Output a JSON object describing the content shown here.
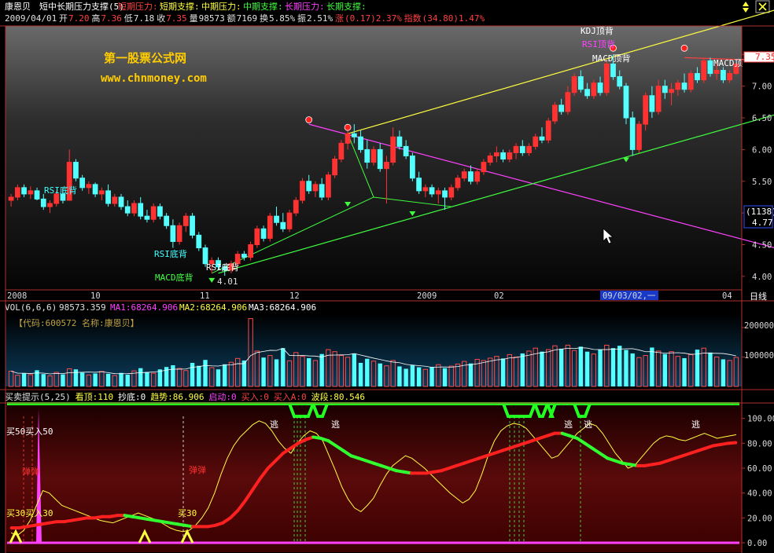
{
  "header": {
    "stock_name": "康恩贝",
    "indicator_name": "短中长期压力支撑(5)",
    "legend": [
      {
        "text": "短期压力:",
        "color": "#ff4040"
      },
      {
        "text": "短期支撑:",
        "color": "#ffff40"
      },
      {
        "text": "中期压力:",
        "color": "#ffff40"
      },
      {
        "text": "中期支撑:",
        "color": "#40ff40"
      },
      {
        "text": "长期压力:",
        "color": "#ff40ff"
      },
      {
        "text": "长期支撑:",
        "color": "#40ff40"
      }
    ],
    "quote": {
      "date": "2009/04/01",
      "open_label": "开",
      "open": "7.20",
      "high_label": "高",
      "high": "7.36",
      "low_label": "低",
      "low": "7.18",
      "close_label": "收",
      "close": "7.35",
      "volume_label": "量",
      "volume": "98573",
      "amount_label": "额",
      "amount": "7169",
      "turnover_label": "换",
      "turnover": "5.85%",
      "amplitude_label": "振",
      "amplitude": "2.51%",
      "change_label": "涨",
      "change": "(0.17)2.37%",
      "index_label": "指数",
      "index": "(34.80)1.47%"
    }
  },
  "watermark": {
    "line1": "第一股票公式网",
    "line2": "www.chnmoney.com"
  },
  "top_right_icons": [
    "arrow-up-down-icon",
    "close-icon"
  ],
  "price_panel": {
    "y_ticks": [
      "7.50",
      "7.00",
      "6.50",
      "6.00",
      "5.50",
      "5.00",
      "4.50",
      "4.00"
    ],
    "current_price_tag": "7.35",
    "side_box": {
      "line1": "(1138)",
      "line2": "4.77"
    },
    "low_marker_label": "4.01",
    "annotations": [
      "RSI底背",
      "RSI底背",
      "RSI底背",
      "MACD底背",
      "KDJ顶背",
      "RSI顶背",
      "MACD顶背",
      "MACD顶"
    ],
    "date_axis": [
      "2008",
      "10",
      "11",
      "12",
      "2009",
      "02",
      "09/03/02,一",
      "04"
    ],
    "date_axis_unit": "日线"
  },
  "volume_panel": {
    "header": {
      "name": "VOL(6,6,6)",
      "value": "98573.359",
      "ma1": "MA1:68264.906",
      "ma2": "MA2:68264.906",
      "ma3": "MA3:68264.906"
    },
    "info": "【代码:600572 名称:康恩贝】",
    "y_ticks": [
      "200000",
      "100000"
    ]
  },
  "osc_panel": {
    "header": [
      {
        "text": "买卖提示(5,25)",
        "color": "#e0e0e0"
      },
      {
        "text": "看顶:110",
        "color": "#ffff40"
      },
      {
        "text": "抄底:0",
        "color": "#ffffff"
      },
      {
        "text": "趋势:86.906",
        "color": "#ffff40"
      },
      {
        "text": "启动:0",
        "color": "#ff40ff"
      },
      {
        "text": "买入:0",
        "color": "#ff4040"
      },
      {
        "text": "买入A:0",
        "color": "#ff4040"
      },
      {
        "text": "波段:80.546",
        "color": "#ffff40"
      }
    ],
    "y_ticks": [
      "100.00",
      "80.00",
      "60.00",
      "40.00",
      "20.00",
      "0.00"
    ],
    "signals": {
      "buy50": "买50买入50",
      "buy30": "买30买入30",
      "buy30b": "买30",
      "rebound": "弹弹",
      "escape": "逃"
    }
  },
  "chart_data": [
    {
      "type": "candlestick",
      "title": "短中长期压力支撑(5)",
      "ylim": [
        3.8,
        7.95
      ],
      "y_ticks": [
        4.0,
        4.5,
        5.0,
        5.5,
        6.0,
        6.5,
        7.0,
        7.5
      ],
      "ohlc": [
        [
          5.2,
          5.3,
          5.1,
          5.25
        ],
        [
          5.25,
          5.45,
          5.2,
          5.4
        ],
        [
          5.4,
          5.45,
          5.25,
          5.3
        ],
        [
          5.3,
          5.42,
          5.22,
          5.35
        ],
        [
          5.35,
          5.4,
          5.2,
          5.22
        ],
        [
          5.22,
          5.3,
          5.05,
          5.1
        ],
        [
          5.1,
          5.2,
          5.0,
          5.15
        ],
        [
          5.15,
          5.35,
          5.1,
          5.3
        ],
        [
          5.3,
          5.4,
          5.15,
          5.2
        ],
        [
          5.2,
          6.0,
          5.2,
          5.8
        ],
        [
          5.8,
          5.85,
          5.5,
          5.55
        ],
        [
          5.55,
          5.6,
          5.35,
          5.4
        ],
        [
          5.4,
          5.5,
          5.3,
          5.45
        ],
        [
          5.45,
          5.48,
          5.25,
          5.3
        ],
        [
          5.3,
          5.4,
          5.2,
          5.35
        ],
        [
          5.35,
          5.45,
          5.1,
          5.15
        ],
        [
          5.15,
          5.3,
          5.1,
          5.25
        ],
        [
          5.25,
          5.3,
          5.05,
          5.1
        ],
        [
          5.1,
          5.2,
          4.95,
          5.0
        ],
        [
          5.0,
          5.2,
          4.95,
          5.15
        ],
        [
          5.15,
          5.25,
          4.9,
          4.95
        ],
        [
          4.95,
          5.05,
          4.85,
          4.9
        ],
        [
          4.9,
          5.15,
          4.85,
          5.1
        ],
        [
          5.1,
          5.15,
          4.9,
          4.95
        ],
        [
          4.95,
          5.0,
          4.75,
          4.8
        ],
        [
          4.8,
          4.9,
          4.45,
          4.55
        ],
        [
          4.55,
          4.85,
          4.5,
          4.8
        ],
        [
          4.8,
          5.0,
          4.7,
          4.95
        ],
        [
          4.95,
          5.0,
          4.6,
          4.65
        ],
        [
          4.65,
          4.7,
          4.4,
          4.45
        ],
        [
          4.45,
          4.5,
          4.15,
          4.2
        ],
        [
          4.2,
          4.3,
          4.05,
          4.25
        ],
        [
          4.25,
          4.3,
          4.1,
          4.15
        ],
        [
          4.15,
          4.2,
          4.01,
          4.1
        ],
        [
          4.1,
          4.25,
          4.05,
          4.2
        ],
        [
          4.2,
          4.4,
          4.15,
          4.35
        ],
        [
          4.35,
          4.4,
          4.25,
          4.3
        ],
        [
          4.3,
          4.55,
          4.25,
          4.5
        ],
        [
          4.5,
          4.8,
          4.45,
          4.75
        ],
        [
          4.75,
          4.8,
          4.55,
          4.6
        ],
        [
          4.6,
          5.0,
          4.55,
          4.95
        ],
        [
          4.95,
          5.1,
          4.8,
          4.85
        ],
        [
          4.85,
          5.0,
          4.7,
          4.75
        ],
        [
          4.75,
          5.05,
          4.7,
          5.0
        ],
        [
          5.0,
          5.25,
          4.95,
          5.2
        ],
        [
          5.2,
          5.55,
          5.15,
          5.5
        ],
        [
          5.5,
          5.6,
          5.3,
          5.35
        ],
        [
          5.35,
          5.5,
          5.25,
          5.45
        ],
        [
          5.45,
          5.55,
          5.2,
          5.25
        ],
        [
          5.25,
          5.65,
          5.2,
          5.6
        ],
        [
          5.6,
          5.9,
          5.55,
          5.85
        ],
        [
          5.85,
          6.15,
          5.8,
          6.1
        ],
        [
          6.1,
          6.3,
          6.0,
          6.25
        ],
        [
          6.25,
          6.4,
          6.1,
          6.2
        ],
        [
          6.2,
          6.3,
          5.95,
          6.0
        ],
        [
          6.0,
          6.15,
          5.7,
          5.8
        ],
        [
          5.8,
          6.05,
          5.75,
          6.0
        ],
        [
          6.0,
          6.1,
          5.65,
          5.7
        ],
        [
          5.7,
          5.9,
          5.15,
          5.8
        ],
        [
          5.8,
          6.35,
          5.75,
          6.2
        ],
        [
          6.2,
          6.3,
          6.0,
          6.05
        ],
        [
          6.05,
          6.15,
          5.85,
          5.9
        ],
        [
          5.9,
          5.95,
          5.5,
          5.55
        ],
        [
          5.55,
          5.65,
          5.3,
          5.35
        ],
        [
          5.35,
          5.45,
          5.25,
          5.4
        ],
        [
          5.4,
          5.45,
          5.25,
          5.3
        ],
        [
          5.3,
          5.4,
          5.15,
          5.35
        ],
        [
          5.35,
          5.4,
          5.05,
          5.25
        ],
        [
          5.25,
          5.45,
          5.2,
          5.4
        ],
        [
          5.4,
          5.6,
          5.35,
          5.55
        ],
        [
          5.55,
          5.7,
          5.5,
          5.65
        ],
        [
          5.65,
          5.75,
          5.45,
          5.5
        ],
        [
          5.5,
          5.7,
          5.45,
          5.65
        ],
        [
          5.65,
          5.85,
          5.6,
          5.8
        ],
        [
          5.8,
          5.95,
          5.75,
          5.9
        ],
        [
          5.9,
          6.05,
          5.8,
          5.95
        ],
        [
          5.95,
          6.0,
          5.8,
          5.85
        ],
        [
          5.85,
          6.0,
          5.8,
          5.95
        ],
        [
          5.95,
          6.1,
          5.85,
          6.05
        ],
        [
          6.05,
          6.15,
          5.9,
          5.95
        ],
        [
          5.95,
          6.1,
          5.9,
          6.05
        ],
        [
          6.05,
          6.25,
          6.0,
          6.2
        ],
        [
          6.2,
          6.35,
          6.1,
          6.15
        ],
        [
          6.15,
          6.5,
          6.1,
          6.45
        ],
        [
          6.45,
          6.75,
          6.4,
          6.7
        ],
        [
          6.7,
          6.8,
          6.55,
          6.6
        ],
        [
          6.6,
          7.0,
          6.55,
          6.9
        ],
        [
          6.9,
          7.2,
          6.85,
          7.15
        ],
        [
          7.15,
          7.25,
          6.9,
          6.95
        ],
        [
          6.95,
          7.05,
          6.8,
          6.85
        ],
        [
          6.85,
          7.1,
          6.8,
          7.05
        ],
        [
          7.05,
          7.15,
          6.85,
          6.9
        ],
        [
          6.9,
          7.4,
          6.85,
          7.35
        ],
        [
          7.35,
          7.5,
          7.1,
          7.15
        ],
        [
          7.15,
          7.25,
          6.95,
          7.0
        ],
        [
          7.0,
          7.05,
          6.4,
          6.5
        ],
        [
          6.5,
          6.6,
          5.9,
          6.0
        ],
        [
          6.0,
          6.45,
          5.95,
          6.4
        ],
        [
          6.4,
          6.9,
          6.3,
          6.85
        ],
        [
          6.85,
          7.0,
          6.5,
          6.6
        ],
        [
          6.6,
          7.1,
          6.55,
          7.0
        ],
        [
          7.0,
          7.1,
          6.8,
          6.9
        ],
        [
          6.9,
          7.05,
          6.7,
          6.95
        ],
        [
          6.95,
          7.1,
          6.85,
          7.05
        ],
        [
          7.05,
          7.2,
          6.9,
          6.95
        ],
        [
          6.95,
          7.25,
          6.9,
          7.2
        ],
        [
          7.2,
          7.3,
          7.05,
          7.1
        ],
        [
          7.1,
          7.45,
          7.05,
          7.4
        ],
        [
          7.4,
          7.45,
          7.15,
          7.2
        ],
        [
          7.2,
          7.35,
          7.1,
          7.25
        ],
        [
          7.25,
          7.3,
          7.05,
          7.1
        ],
        [
          7.1,
          7.25,
          7.05,
          7.2
        ],
        [
          7.2,
          7.36,
          7.18,
          7.35
        ]
      ],
      "lines": [
        {
          "name": "中期压力",
          "color": "#ffff40",
          "from": [
            52,
            6.25
          ],
          "to": [
            118,
            8.2
          ]
        },
        {
          "name": "长期压力",
          "color": "#ff40ff",
          "from": [
            46,
            6.4
          ],
          "to": [
            118,
            4.45
          ]
        },
        {
          "name": "中期支撑",
          "color": "#40ff40",
          "from": [
            32,
            4.05
          ],
          "to": [
            118,
            6.55
          ]
        },
        {
          "name": "短期压力",
          "color": "#ff4040",
          "from": [
            104,
            7.45
          ],
          "to": [
            118,
            7.4
          ]
        }
      ]
    },
    {
      "type": "bar",
      "title": "VOL(6,6,6)",
      "ylim": [
        0,
        245000
      ],
      "y_ticks": [
        100000,
        200000
      ],
      "values": [
        52000,
        38000,
        45000,
        40000,
        55000,
        42000,
        36000,
        48000,
        41000,
        60000,
        58000,
        47000,
        39000,
        44000,
        51000,
        43000,
        37000,
        46000,
        40000,
        53000,
        62000,
        49000,
        45000,
        58000,
        66000,
        72000,
        61000,
        54000,
        80000,
        70000,
        90000,
        64000,
        58000,
        75000,
        82000,
        95000,
        88000,
        230000,
        120000,
        98000,
        105000,
        92000,
        130000,
        87000,
        115000,
        102000,
        96000,
        88000,
        110000,
        125000,
        118000,
        105000,
        99000,
        112000,
        80000,
        94000,
        86000,
        78000,
        70000,
        88000,
        68000,
        60000,
        72000,
        65000,
        58000,
        66000,
        74000,
        62000,
        69000,
        76000,
        85000,
        78000,
        92000,
        88000,
        96000,
        102000,
        95000,
        108000,
        100000,
        112000,
        120000,
        130000,
        118000,
        125000,
        138000,
        128000,
        140000,
        122000,
        135000,
        118000,
        110000,
        125000,
        140000,
        130000,
        138000,
        124000,
        112000,
        98000,
        105000,
        132000,
        120000,
        110000,
        118000,
        102000,
        96000,
        108000,
        125000,
        130000,
        115000,
        100000,
        92000,
        88000,
        98573
      ],
      "ma_values": {
        "ma1": 68264.906,
        "ma2": 68264.906,
        "ma3": 68264.906
      }
    },
    {
      "type": "line",
      "title": "买卖提示(5,25)",
      "ylim": [
        0,
        110
      ],
      "y_ticks": [
        0,
        20,
        40,
        60,
        80,
        100
      ],
      "series": [
        {
          "name": "趋势",
          "color": "#ffff40",
          "values": [
            8,
            6,
            10,
            18,
            30,
            42,
            40,
            35,
            30,
            28,
            26,
            24,
            22,
            20,
            18,
            17,
            16,
            18,
            20,
            22,
            24,
            22,
            20,
            18,
            15,
            12,
            10,
            9,
            10,
            14,
            20,
            28,
            40,
            55,
            68,
            78,
            85,
            90,
            95,
            98,
            96,
            90,
            82,
            76,
            72,
            80,
            86,
            90,
            88,
            82,
            70,
            58,
            45,
            35,
            28,
            25,
            30,
            36,
            46,
            55,
            62,
            66,
            70,
            68,
            64,
            60,
            55,
            50,
            45,
            40,
            36,
            32,
            35,
            42,
            55,
            70,
            82,
            90,
            94,
            96,
            95,
            92,
            86,
            80,
            74,
            68,
            70,
            76,
            82,
            88,
            92,
            96,
            94,
            88,
            80,
            72,
            66,
            60,
            62,
            68,
            74,
            80,
            84,
            86,
            85,
            83,
            82,
            84,
            86,
            88,
            86,
            84,
            85,
            86,
            86.9
          ]
        },
        {
          "name": "波段",
          "color": "#ff3030",
          "values": [
            12,
            12,
            13,
            14,
            15,
            16,
            17,
            17,
            18,
            19,
            20,
            20,
            21,
            21,
            22,
            22,
            21,
            20,
            19,
            18,
            17,
            16,
            15,
            14,
            13,
            13,
            13,
            14,
            16,
            20,
            26,
            34,
            43,
            52,
            60,
            66,
            72,
            76,
            80,
            83,
            85,
            84,
            82,
            78,
            74,
            70,
            68,
            66,
            64,
            62,
            60,
            58,
            57,
            56,
            56,
            56,
            57,
            58,
            60,
            62,
            64,
            66,
            68,
            70,
            72,
            74,
            76,
            78,
            80,
            82,
            84,
            86,
            88,
            88,
            86,
            84,
            80,
            76,
            72,
            68,
            66,
            64,
            63,
            62,
            62,
            63,
            64,
            66,
            68,
            70,
            72,
            74,
            76,
            78,
            79,
            80,
            80.5
          ]
        }
      ]
    }
  ]
}
